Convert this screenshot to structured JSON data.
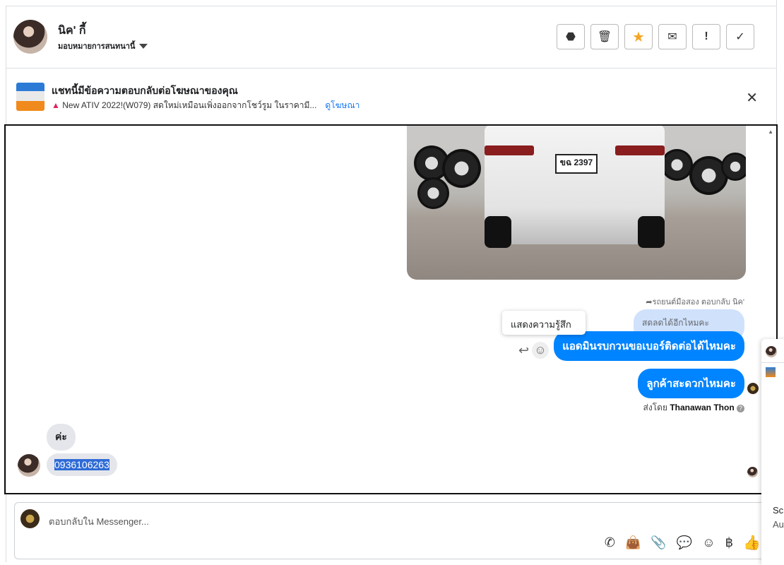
{
  "header": {
    "contact_name": "นิค' กี้",
    "assign_label": "มอบหมายการสนทนานี้",
    "actions": [
      {
        "icon": "alert-octagon-icon",
        "glyph": "⬣"
      },
      {
        "icon": "trash-icon",
        "glyph": "🗑"
      },
      {
        "icon": "star-icon",
        "glyph": "★"
      },
      {
        "icon": "envelope-icon",
        "glyph": "✉"
      },
      {
        "icon": "exclamation-icon",
        "glyph": "!"
      },
      {
        "icon": "check-icon",
        "glyph": "✓"
      }
    ]
  },
  "ad_banner": {
    "title": "แชทนี้มีข้อความตอบกลับต่อโฆษณาของคุณ",
    "subtitle": "New ATIV 2022!(W079) สดใหม่เหมือนเพิ่งออกจากโชว์รูม ในราคามี...",
    "link": "ดูโฆษณา"
  },
  "chat": {
    "plate": "ขฉ 2397",
    "reply_note": "รถยนต์มือสอง ตอบกลับ นิค'",
    "quoted": "สดลดได้อีกไหมคะ",
    "tooltip": "แสดงความรู้สึก",
    "messages_out": [
      "แอดมินรบกวนขอเบอร์ติดต่อได้ไหมคะ",
      "ลูกค้าสะดวกไหมคะ"
    ],
    "sent_by_prefix": "ส่งโดย",
    "sent_by_name": "Thanawan Thon",
    "messages_in": [
      "ค่ะ",
      "0936106263"
    ]
  },
  "composer": {
    "placeholder": "ตอบกลับใน Messenger...",
    "tools": [
      "phone-plus-icon",
      "shopping-bag-icon",
      "paperclip-icon",
      "chat-bubble-icon",
      "emoji-icon",
      "baht-icon",
      "thumbs-up-icon"
    ]
  },
  "side_panel": {
    "text1": "Sc",
    "text2": "Au"
  },
  "colors": {
    "accent": "#0084ff",
    "star": "#f5a623"
  }
}
